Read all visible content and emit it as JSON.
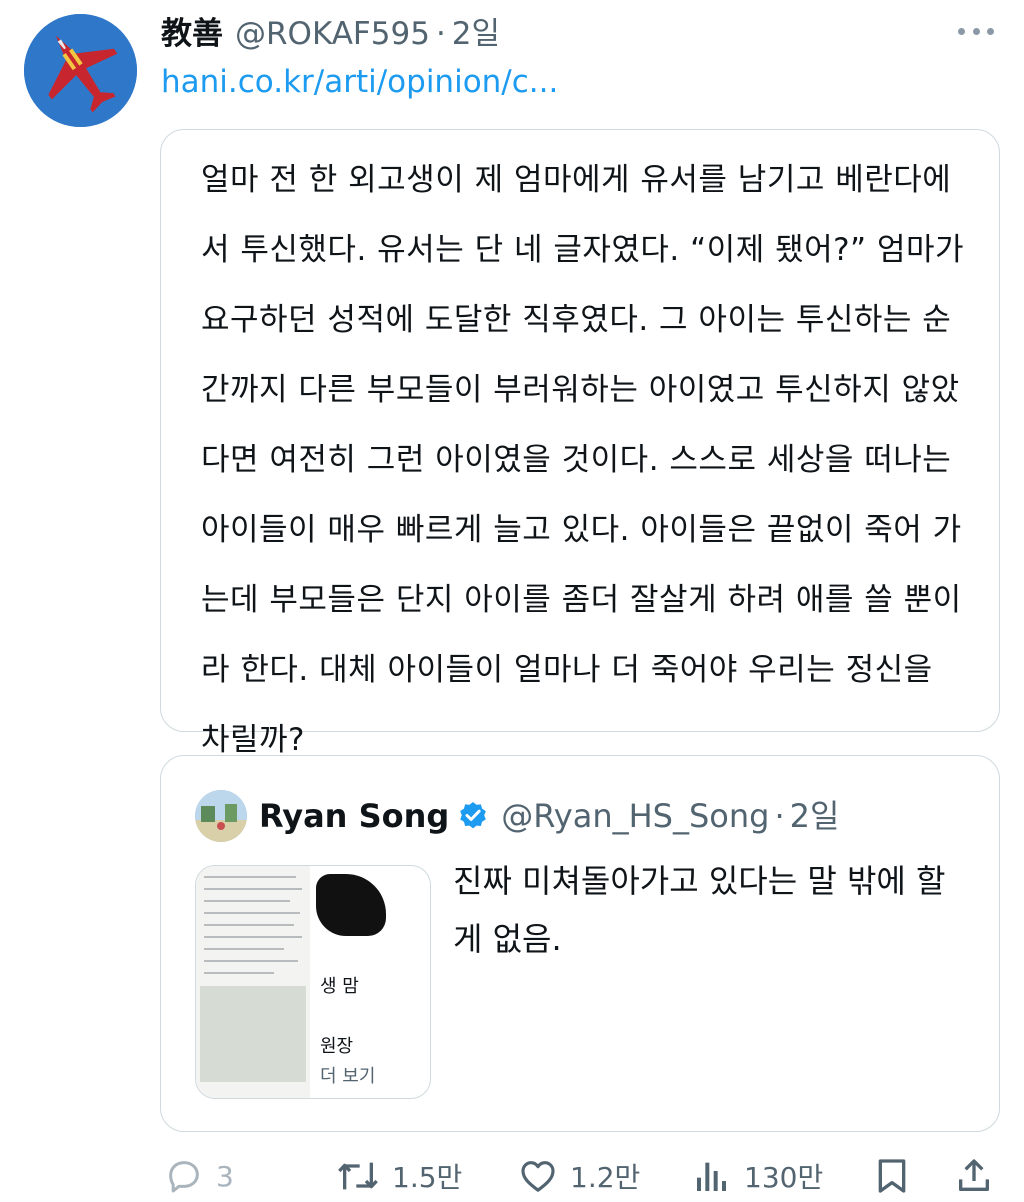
{
  "tweet": {
    "display_name": "教善",
    "handle": "@ROKAF595",
    "separator": "·",
    "time": "2일",
    "link": "hani.co.kr/arti/opinion/c...",
    "avatar_icon": "fighter-jet-avatar",
    "quote_text": "얼마 전 한 외고생이 제 엄마에게 유서를 남기고 베란다에서 투신했다. 유서는 단 네 글자였다. “이제 됐어?” 엄마가 요구하던 성적에 도달한 직후였다. 그 아이는 투신하는 순간까지 다른 부모들이 부러워하는 아이였고 투신하지 않았다면 여전히 그런 아이였을 것이다. 스스로 세상을 떠나는 아이들이 매우 빠르게 늘고 있다. 아이들은 끝없이 죽어 가는데 부모들은 단지 아이를 좀더 잘살게 하려 애를 쓸 뿐이라 한다. 대체 아이들이 얼마나 더 죽어야 우리는 정신을 차릴까?"
  },
  "quoted_tweet": {
    "name": "Ryan Song",
    "handle": "@Ryan_HS_Song",
    "separator": "·",
    "time": "2일",
    "verified_icon": "verified-badge-icon",
    "text": "진짜 미쳐돌아가고 있다는 말 밖에 할 게 없음.",
    "thumbnail": {
      "text_1": "생 맘",
      "text_2": "원장",
      "text_3": "더 보기"
    }
  },
  "actions": {
    "reply": {
      "icon": "reply-icon",
      "count": "3"
    },
    "retweet": {
      "icon": "retweet-icon",
      "count": "1.5만"
    },
    "like": {
      "icon": "heart-icon",
      "count": "1.2만"
    },
    "views": {
      "icon": "views-icon",
      "count": "130만"
    },
    "bookmark": {
      "icon": "bookmark-icon"
    },
    "share": {
      "icon": "share-icon"
    }
  },
  "colors": {
    "link": "#1d9bf0",
    "secondary_text": "#536471",
    "border": "#cfd9de",
    "verified": "#1d9bf0"
  }
}
